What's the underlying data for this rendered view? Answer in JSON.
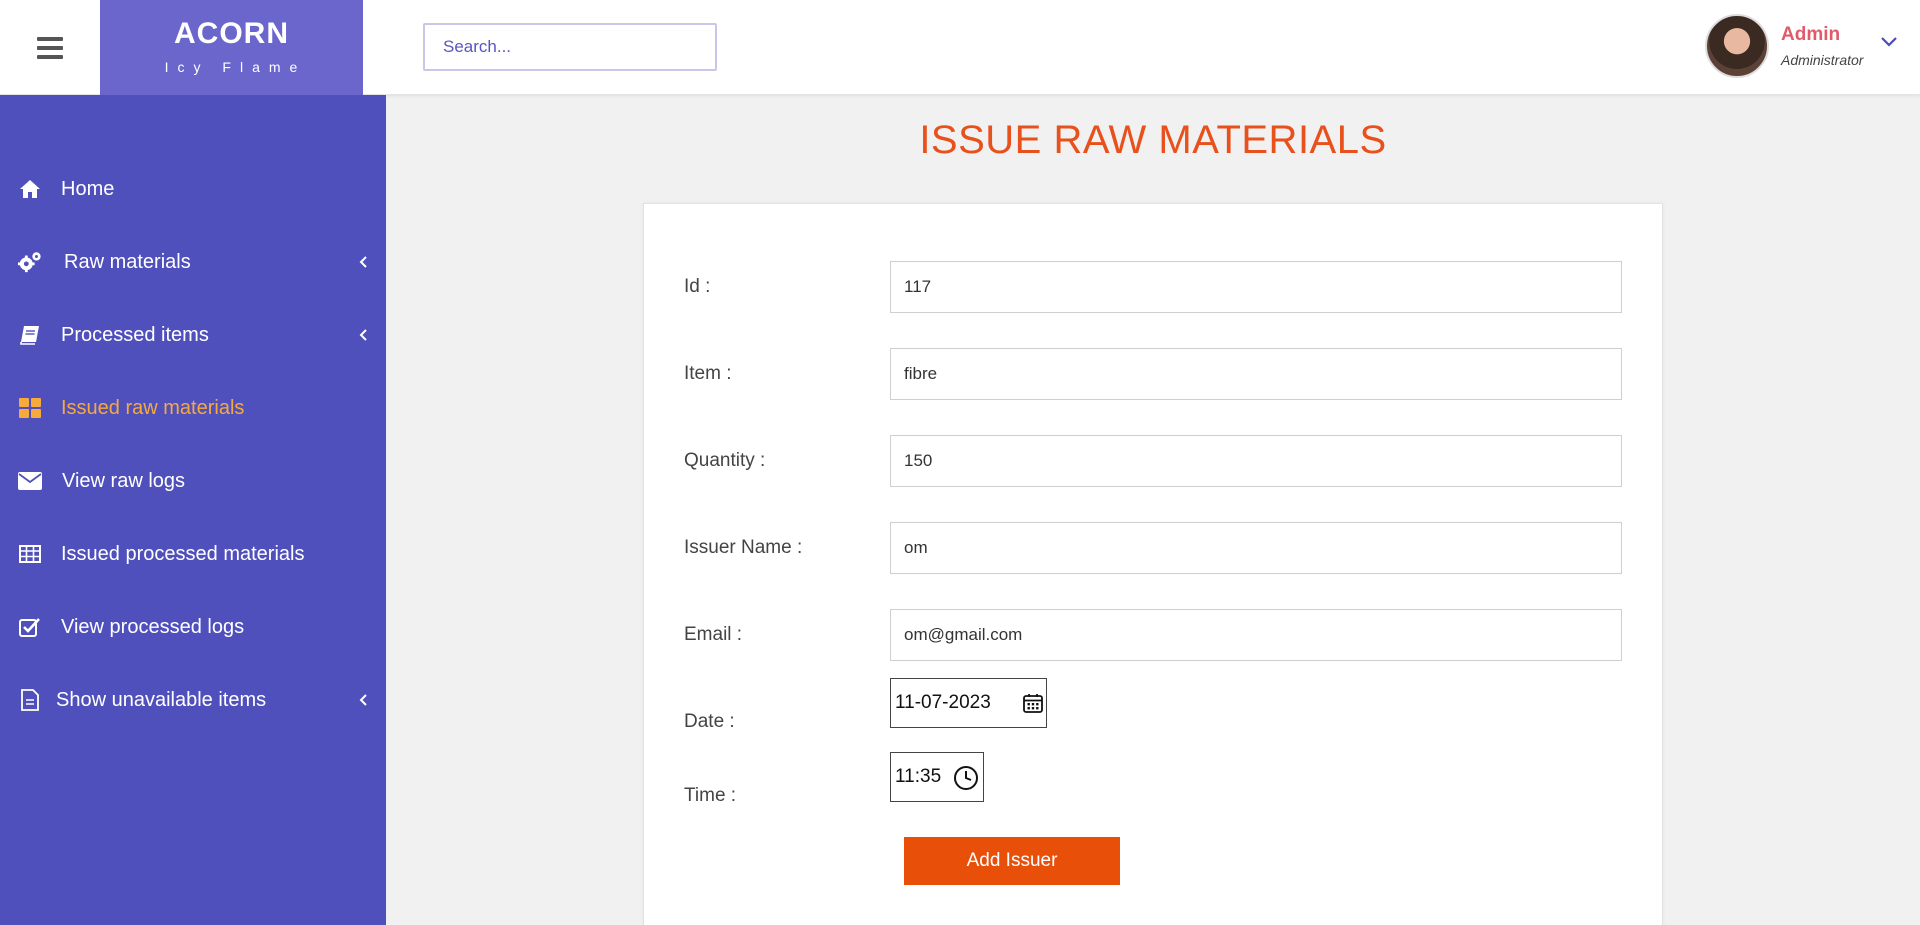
{
  "brand": {
    "name": "ACORN",
    "subtitle": "Icy Flame"
  },
  "search": {
    "placeholder": "Search..."
  },
  "user": {
    "name": "Admin",
    "role": "Administrator"
  },
  "sidebar": {
    "items": [
      {
        "label": "Home",
        "icon": "home-icon",
        "has_submenu": false,
        "active": false
      },
      {
        "label": "Raw materials",
        "icon": "gears-icon",
        "has_submenu": true,
        "active": false
      },
      {
        "label": "Processed items",
        "icon": "book-icon",
        "has_submenu": true,
        "active": false
      },
      {
        "label": "Issued raw materials",
        "icon": "grid-icon",
        "has_submenu": false,
        "active": true
      },
      {
        "label": "View raw logs",
        "icon": "envelope-icon",
        "has_submenu": false,
        "active": false
      },
      {
        "label": "Issued processed materials",
        "icon": "table-icon",
        "has_submenu": false,
        "active": false
      },
      {
        "label": "View processed logs",
        "icon": "check-square-icon",
        "has_submenu": false,
        "active": false
      },
      {
        "label": "Show unavailable items",
        "icon": "file-icon",
        "has_submenu": true,
        "active": false
      }
    ]
  },
  "page": {
    "title": "ISSUE RAW MATERIALS"
  },
  "form": {
    "id": {
      "label": "Id :",
      "value": "117"
    },
    "item": {
      "label": "Item :",
      "value": "fibre"
    },
    "quantity": {
      "label": "Quantity :",
      "value": "150"
    },
    "issuer_name": {
      "label": "Issuer Name :",
      "value": "om"
    },
    "email": {
      "label": "Email :",
      "value": "om@gmail.com"
    },
    "date": {
      "label": "Date :",
      "value": "11-07-2023"
    },
    "time": {
      "label": "Time :",
      "value": "11:35"
    },
    "submit_label": "Add Issuer"
  },
  "colors": {
    "sidebar_bg": "#5050bc",
    "brand_bg": "#6b66cc",
    "active_nav": "#f7a93b",
    "title": "#e8501c",
    "button": "#e8500a",
    "user_name": "#e05a6a"
  }
}
